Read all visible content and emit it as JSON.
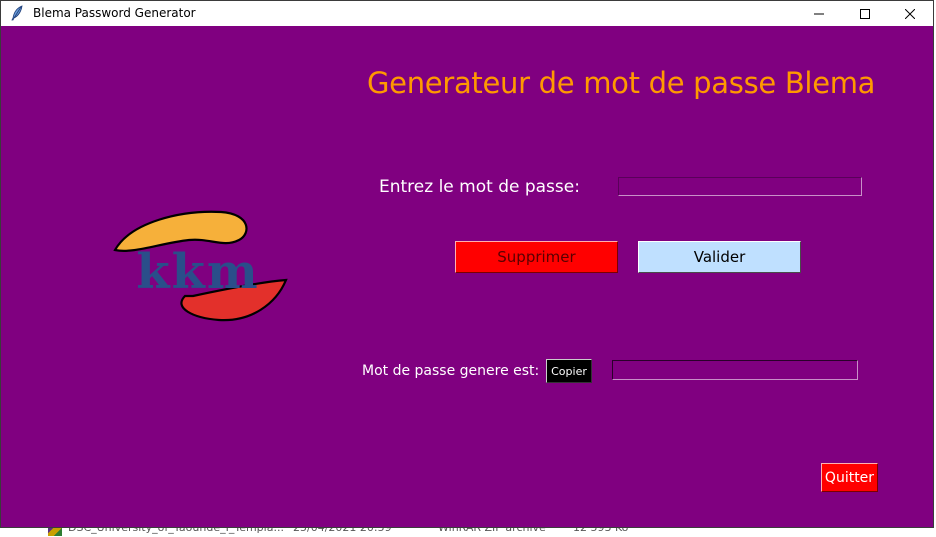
{
  "window": {
    "title": "Blema Password Generator",
    "icon": "feather-icon",
    "controls": [
      "minimize-icon",
      "maximize-icon",
      "close-icon"
    ]
  },
  "app": {
    "heading": "Generateur de mot de passe Blema",
    "password_label": "Entrez le mot de passe:",
    "password_value": "",
    "delete_button": "Supprimer",
    "validate_button": "Valider",
    "result_label": "Mot de passe genere est:",
    "copy_button": "Copier",
    "result_value": "",
    "quit_button": "Quitter",
    "logo_text": "kkm"
  },
  "background_row": {
    "name": "DSC_University_of_Yaounde_I_Templa...",
    "date": "25/04/2021 20:59",
    "type": "WinRAR ZIP archive",
    "size": "12 593 Ko"
  },
  "colors": {
    "window_background": "#800080",
    "heading": "#ff9900",
    "delete_button": "#ff0000",
    "validate_button": "#bfe0ff",
    "copy_button": "#000000",
    "quit_button": "#ff0000",
    "logo_top": "#f6b03a",
    "logo_bottom": "#e3302b",
    "logo_text": "#2a4e8a"
  }
}
